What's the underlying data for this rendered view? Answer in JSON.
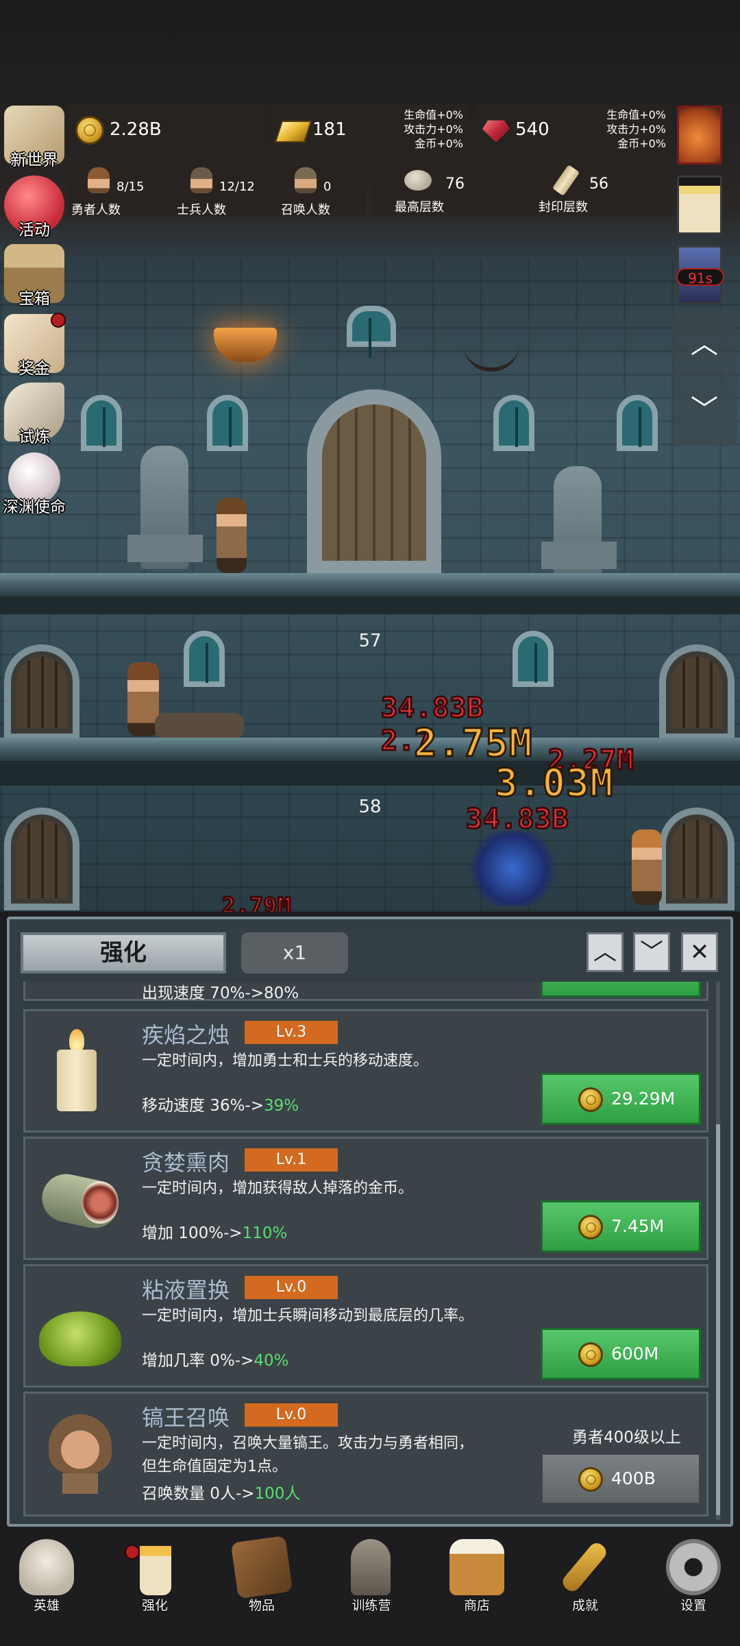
{
  "resources": {
    "gold": "2.28B",
    "gold_bars": "181",
    "gems": "540",
    "bars_bonus": [
      "生命值+0%",
      "攻击力+0%",
      "金币+0%"
    ],
    "gems_bonus": [
      "生命值+0%",
      "攻击力+0%",
      "金币+0%"
    ]
  },
  "counts": {
    "hero": {
      "value": "8/15",
      "label": "勇者人数"
    },
    "soldier": {
      "value": "12/12",
      "label": "士兵人数"
    },
    "summon": {
      "value": "0",
      "label": "召唤人数"
    },
    "top_floor": {
      "value": "76",
      "label": "最高层数"
    },
    "sealed_floor": {
      "value": "56",
      "label": "封印层数"
    }
  },
  "side_menu": {
    "new_world": "新世界",
    "events": "活动",
    "chest": "宝箱",
    "bonus": "奖金",
    "trial": "试炼",
    "abyss": "深渊使命"
  },
  "right_panel": {
    "timer": "91s"
  },
  "scene": {
    "floors": [
      "57",
      "58"
    ],
    "damage_numbers": [
      "34.83B",
      "2.75M",
      "2.27M",
      "3.03M",
      "34.83B",
      "2.7",
      "2.79M"
    ]
  },
  "panel": {
    "tab_active": "强化",
    "multiplier": "x1",
    "partial_row": {
      "stat": "出现速度 70%->80%"
    },
    "items": [
      {
        "name": "疾焰之烛",
        "level": "Lv.3",
        "desc": "一定时间内，增加勇士和士兵的移动速度。",
        "stat_label": "移动速度 36%->",
        "stat_new": "39%",
        "cost": "29.29M"
      },
      {
        "name": "贪婪熏肉",
        "level": "Lv.1",
        "desc": "一定时间内，增加获得敌人掉落的金币。",
        "stat_label": "增加 100%->",
        "stat_new": "110%",
        "cost": "7.45M"
      },
      {
        "name": "粘液置换",
        "level": "Lv.0",
        "desc": "一定时间内，增加士兵瞬间移动到最底层的几率。",
        "stat_label": "增加几率 0%->",
        "stat_new": "40%",
        "cost": "600M"
      },
      {
        "name": "镐王召唤",
        "level": "Lv.0",
        "desc1": "一定时间内，召唤大量镐王。攻击力与勇者相同，",
        "desc2": "但生命值固定为1点。",
        "stat_label": "召唤数量 0人->",
        "stat_new": "100人",
        "requirement": "勇者400级以上",
        "cost": "400B"
      }
    ]
  },
  "bottom_nav": [
    "英雄",
    "强化",
    "物品",
    "训练营",
    "商店",
    "成就",
    "设置"
  ],
  "colors": {
    "accent_green": "#58e070",
    "level_badge": "#d46a1f",
    "buy_button": "#3fb556",
    "damage_red": "#e8323a",
    "damage_orange": "#f6b23a"
  },
  "icons": {
    "gold": "gold-coin-icon",
    "bars": "gold-bar-icon",
    "gems": "red-gem-icon"
  }
}
